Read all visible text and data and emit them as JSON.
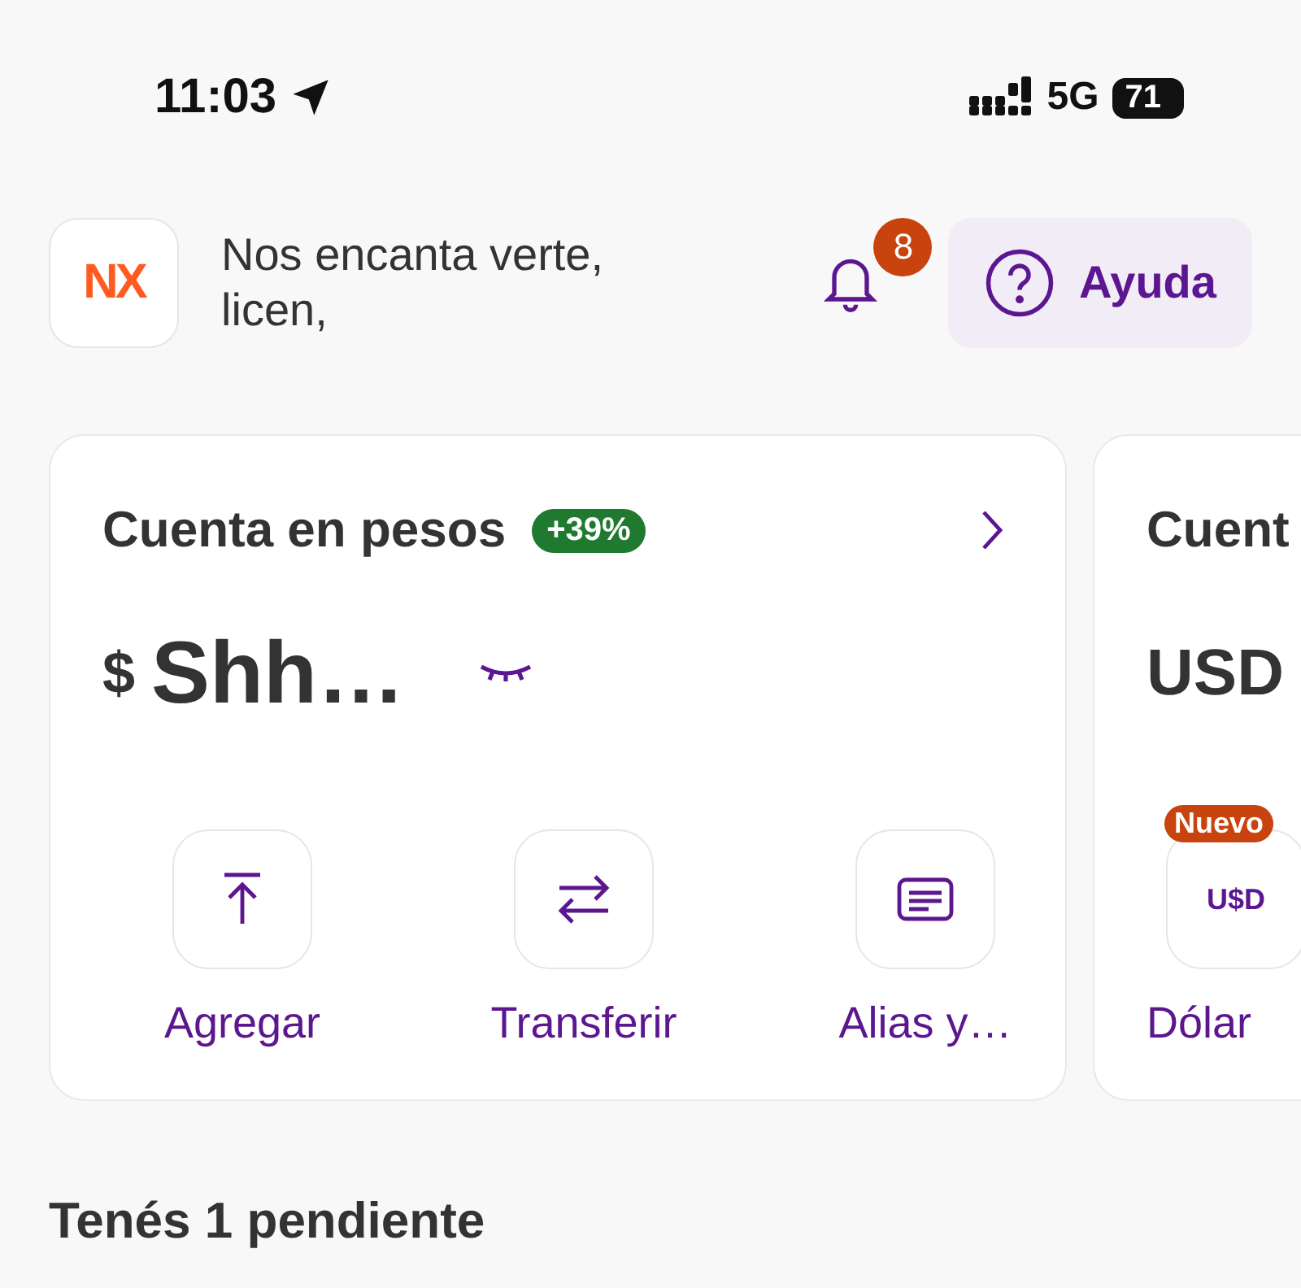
{
  "status_bar": {
    "time": "11:03",
    "network": "5G",
    "battery": "71"
  },
  "header": {
    "logo": "NX",
    "greeting": "Nos encanta verte,",
    "name": "licen,",
    "notifications": "8",
    "help": "Ayuda"
  },
  "accounts": [
    {
      "title": "Cuenta en pesos",
      "badge": "+39%",
      "currency": "$",
      "balance": "Shh…",
      "hidden": true,
      "actions": [
        {
          "kind": "add",
          "label": "Agregar"
        },
        {
          "kind": "transfer",
          "label": "Transferir"
        },
        {
          "kind": "alias",
          "label": "Alias y…"
        }
      ]
    },
    {
      "title": "Cuent",
      "currency": "USD",
      "actions": [
        {
          "kind": "text",
          "icon_text": "U$D",
          "tag": "Nuevo",
          "label": "Dólar"
        }
      ]
    }
  ],
  "pending": {
    "title": "Tenés 1 pendiente"
  }
}
